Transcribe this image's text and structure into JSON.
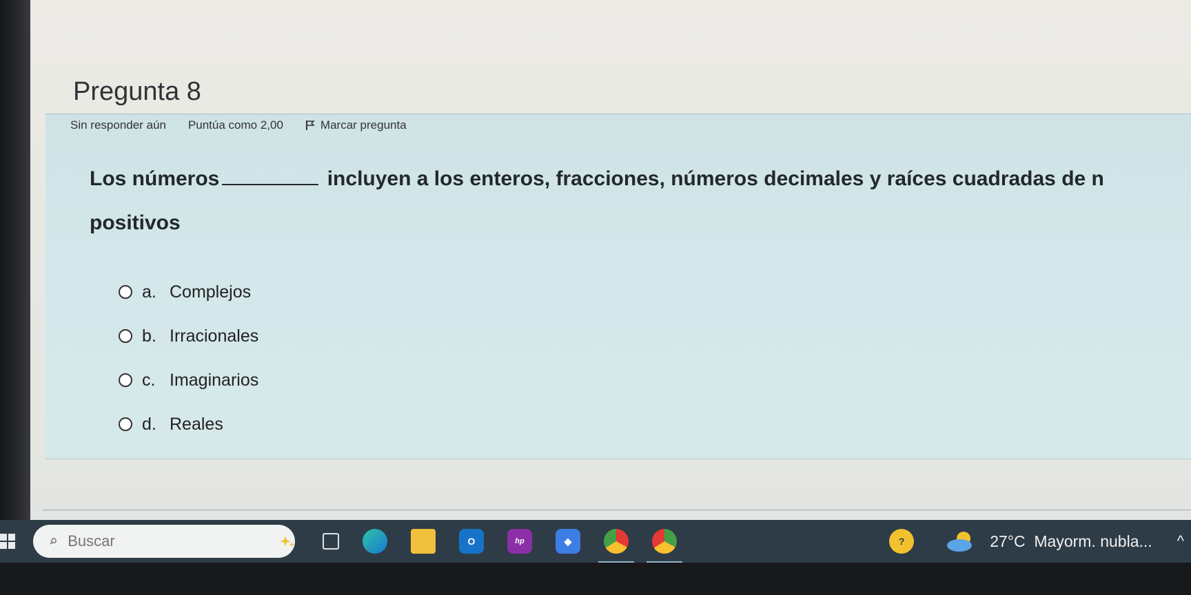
{
  "question": {
    "title": "Pregunta 8",
    "status": "Sin responder aún",
    "score": "Puntúa como 2,00",
    "flag_label": "Marcar pregunta",
    "text_before": "Los números",
    "text_after": "incluyen a los enteros, fracciones, números decimales y raíces cuadradas de n",
    "text_line2": "positivos",
    "options": [
      {
        "letter": "a.",
        "label": "Complejos"
      },
      {
        "letter": "b.",
        "label": "Irracionales"
      },
      {
        "letter": "c.",
        "label": "Imaginarios"
      },
      {
        "letter": "d.",
        "label": "Reales"
      }
    ]
  },
  "taskbar": {
    "search_placeholder": "Buscar",
    "temperature": "27°C",
    "weather": "Mayorm. nubla...",
    "chevron": "^",
    "icons": [
      "windows-icon",
      "search-icon",
      "copilot-icon",
      "task-view-icon",
      "edge-icon",
      "file-explorer-icon",
      "outlook-icon",
      "hp-icon",
      "dropbox-icon",
      "chrome-icon",
      "chrome-profile-icon",
      "help-icon",
      "weather-cloud-icon"
    ]
  }
}
